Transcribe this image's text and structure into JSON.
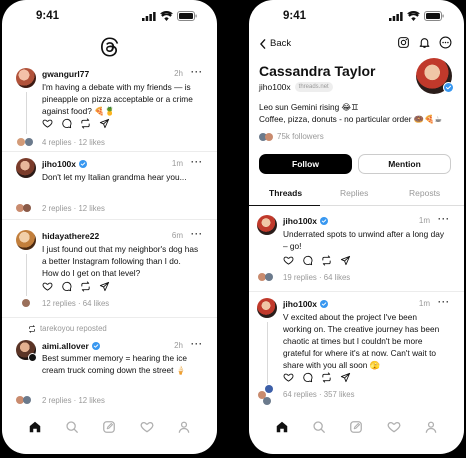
{
  "left": {
    "status": {
      "time": "9:41"
    },
    "posts": [
      {
        "user": "gwangurl77",
        "verified": false,
        "time": "2h",
        "text": "I'm having a debate with my friends — is pineapple on pizza acceptable or a crime against food? 🍕🍍",
        "replies": "4 replies",
        "likes": "12 likes",
        "sep": "·"
      },
      {
        "user": "jiho100x",
        "verified": true,
        "time": "1m",
        "text": "Don't let my Italian grandma hear you...",
        "replies": "2 replies",
        "likes": "12 likes",
        "sep": "·"
      },
      {
        "user": "hidayathere22",
        "verified": false,
        "time": "6m",
        "text": "I just found out that my neighbor's dog has a better Instagram following than I do. How do I get on that level?",
        "replies": "12 replies",
        "likes": "64 likes",
        "sep": "·"
      },
      {
        "user": "aimi.allover",
        "verified": true,
        "time": "2h",
        "text": "Best summer memory = hearing the ice cream truck coming down the street 🍦",
        "replies": "2 replies",
        "likes": "12 likes",
        "sep": "·"
      }
    ],
    "repost_label": "tarekoyou reposted"
  },
  "right": {
    "status": {
      "time": "9:41"
    },
    "back_label": "Back",
    "profile": {
      "name": "Cassandra Taylor",
      "handle": "jiho100x",
      "domain": "threads.net",
      "bio_line1": "Leo sun Gemini rising 😂♊",
      "bio_line2": "Coffee, pizza, donuts - no particular order 🍩🍕☕",
      "followers": "75k followers"
    },
    "buttons": {
      "follow": "Follow",
      "mention": "Mention"
    },
    "tabs": [
      "Threads",
      "Replies",
      "Reposts"
    ],
    "posts": [
      {
        "user": "jiho100x",
        "time": "1m",
        "text": "Underrated spots to unwind after a long day – go!",
        "replies": "19 replies",
        "likes": "64 likes",
        "sep": "·"
      },
      {
        "user": "jiho100x",
        "time": "1m",
        "text": "V excited about the project I've been working on. The creative journey has been chaotic at times but I couldn't be more grateful for where it's at now. Can't wait to share with you all soon 🫣",
        "replies": "64 replies",
        "likes": "357 likes",
        "sep": "·"
      }
    ]
  },
  "more_glyph": "···",
  "colors": {
    "verified": "#3897f0",
    "divider": "#ececec",
    "muted": "#999999"
  }
}
